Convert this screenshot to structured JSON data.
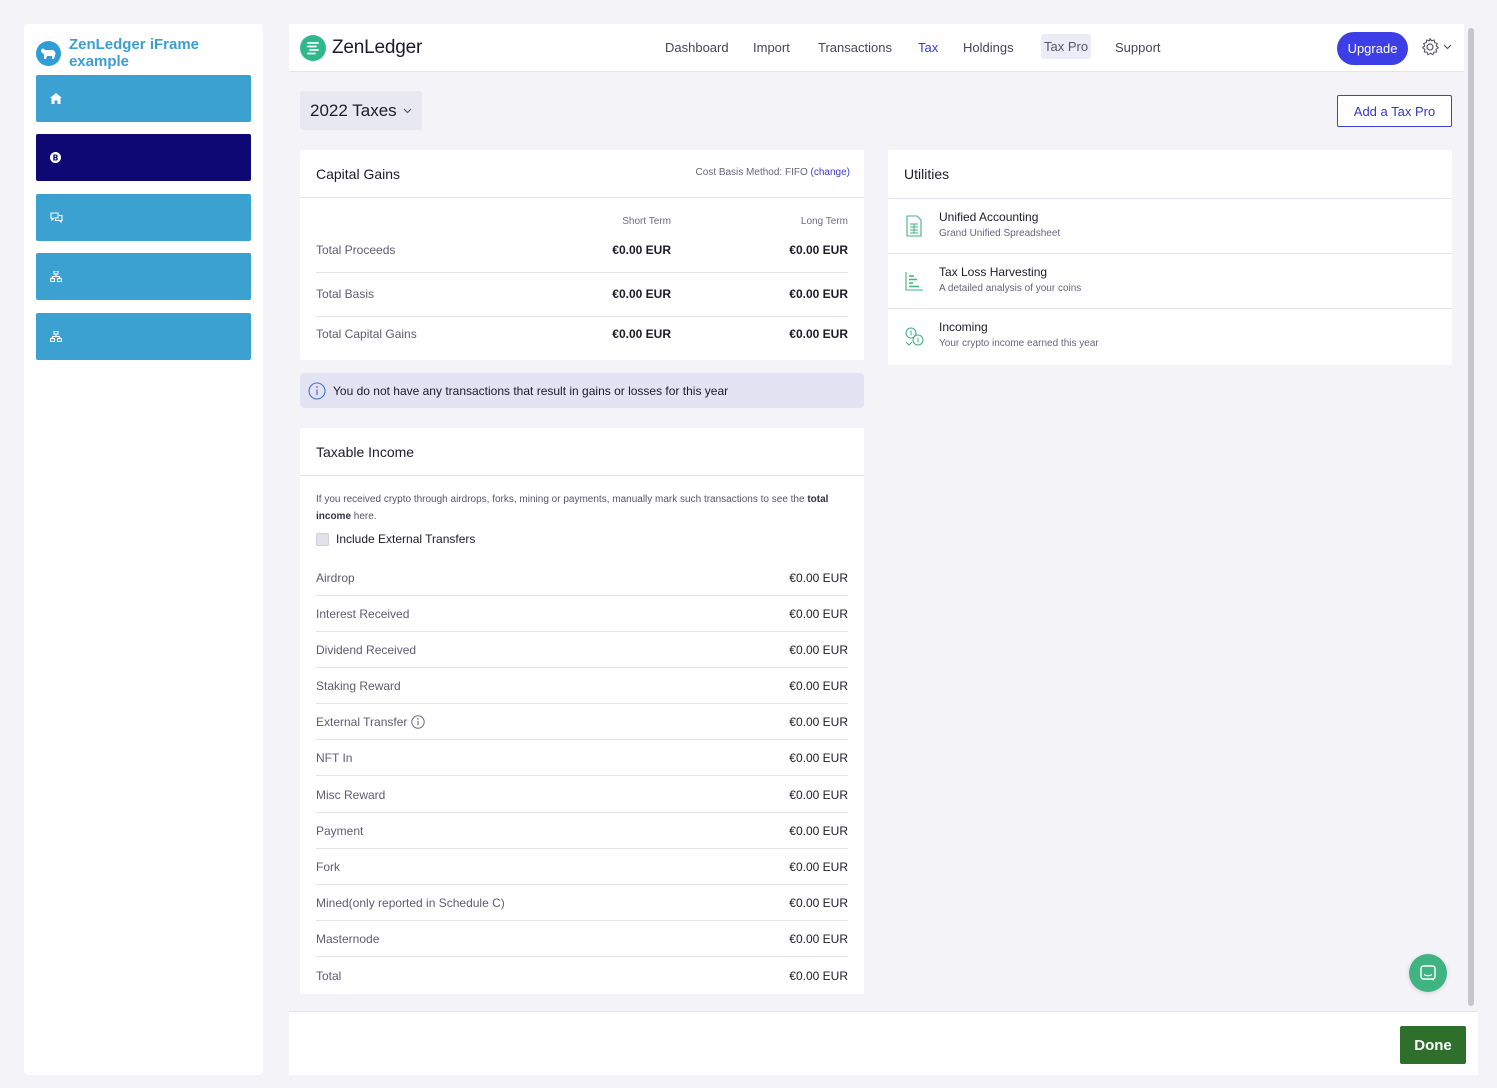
{
  "host": {
    "title": "ZenLedger iFrame example",
    "buttons": [
      {
        "icon": "home-icon",
        "active": false
      },
      {
        "icon": "bitcoin-icon",
        "active": true
      },
      {
        "icon": "chat-icon",
        "active": false
      },
      {
        "icon": "sitemap-icon",
        "active": false
      },
      {
        "icon": "sitemap-icon",
        "active": false
      }
    ]
  },
  "nav": {
    "brand": "ZenLedger",
    "items": [
      "Dashboard",
      "Import",
      "Transactions",
      "Tax",
      "Holdings",
      "Tax Pro",
      "Support"
    ],
    "active": "Tax",
    "upgrade": "Upgrade"
  },
  "year_select": "2022 Taxes",
  "add_tax_pro": "Add a Tax Pro",
  "capital_gains": {
    "title": "Capital Gains",
    "method_prefix": "Cost Basis Method: FIFO",
    "method_link": "(change)",
    "columns": [
      "Short Term",
      "Long Term"
    ],
    "rows": [
      {
        "label": "Total Proceeds",
        "short": "€0.00 EUR",
        "long": "€0.00 EUR"
      },
      {
        "label": "Total Basis",
        "short": "€0.00 EUR",
        "long": "€0.00 EUR"
      },
      {
        "label": "Total Capital Gains",
        "short": "€0.00 EUR",
        "long": "€0.00 EUR"
      }
    ]
  },
  "notice": "You do not have any transactions that result in gains or losses for this year",
  "taxable_income": {
    "title": "Taxable Income",
    "desc_pre": "If you received crypto through airdrops, forks, mining or payments, manually mark such transactions to see the ",
    "desc_bold": "total income",
    "desc_post": " here.",
    "external_label": "Include External Transfers",
    "rows": [
      {
        "label": "Airdrop",
        "value": "€0.00 EUR"
      },
      {
        "label": "Interest Received",
        "value": "€0.00 EUR"
      },
      {
        "label": "Dividend Received",
        "value": "€0.00 EUR"
      },
      {
        "label": "Staking Reward",
        "value": "€0.00 EUR"
      },
      {
        "label": "External Transfer",
        "value": "€0.00 EUR"
      },
      {
        "label": "NFT In",
        "value": "€0.00 EUR"
      },
      {
        "label": "Misc Reward",
        "value": "€0.00 EUR"
      },
      {
        "label": "Payment",
        "value": "€0.00 EUR"
      },
      {
        "label": "Fork",
        "value": "€0.00 EUR"
      },
      {
        "label": "Mined(only reported in Schedule C)",
        "value": "€0.00 EUR"
      },
      {
        "label": "Masternode",
        "value": "€0.00 EUR"
      },
      {
        "label": "Total",
        "value": "€0.00 EUR"
      }
    ]
  },
  "utilities": {
    "title": "Utilities",
    "items": [
      {
        "title": "Unified Accounting",
        "sub": "Grand Unified Spreadsheet",
        "icon": "spreadsheet-icon"
      },
      {
        "title": "Tax Loss Harvesting",
        "sub": "A detailed analysis of your coins",
        "icon": "bar-chart-icon"
      },
      {
        "title": "Incoming",
        "sub": "Your crypto income earned this year",
        "icon": "coins-icon"
      }
    ]
  },
  "footer": {
    "done": "Done"
  },
  "colors": {
    "accent": "#3e3ee6",
    "brand_green": "#2fb98a",
    "host_blue": "#3aa1d1",
    "host_active": "#0d0873",
    "done_green": "#2d6f2b"
  }
}
